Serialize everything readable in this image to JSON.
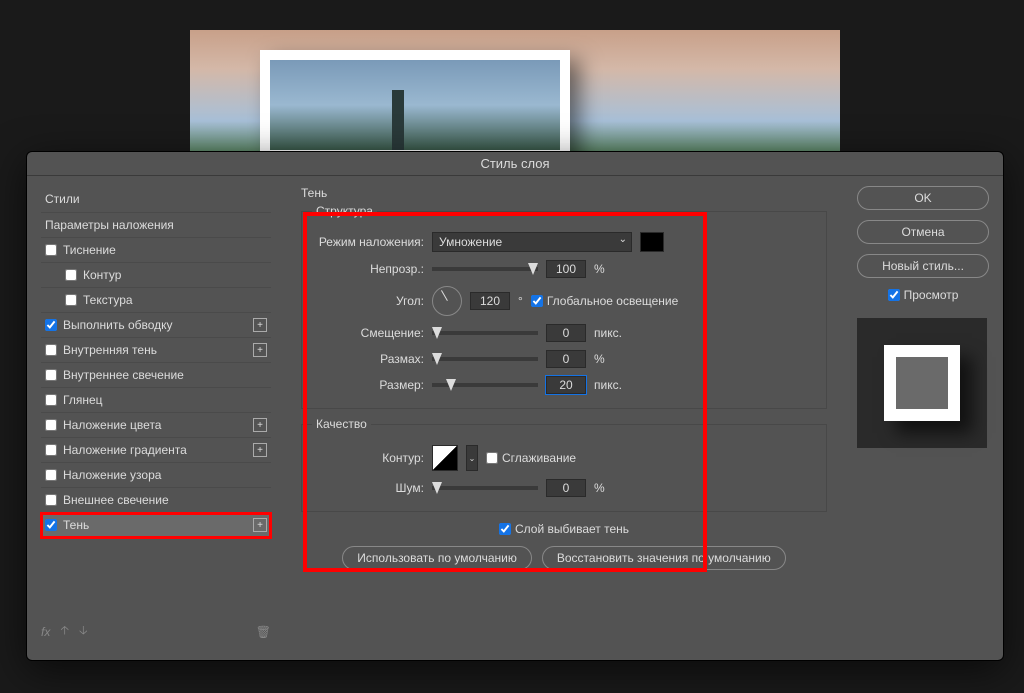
{
  "dialog": {
    "title": "Стиль слоя"
  },
  "sidebar": {
    "styles": "Стили",
    "blending": "Параметры наложения",
    "items": [
      {
        "label": "Тиснение",
        "checked": false,
        "add": false
      },
      {
        "label": "Контур",
        "checked": false,
        "add": false,
        "indent": true
      },
      {
        "label": "Текстура",
        "checked": false,
        "add": false,
        "indent": true
      },
      {
        "label": "Выполнить обводку",
        "checked": true,
        "add": true
      },
      {
        "label": "Внутренняя тень",
        "checked": false,
        "add": true
      },
      {
        "label": "Внутреннее свечение",
        "checked": false,
        "add": false
      },
      {
        "label": "Глянец",
        "checked": false,
        "add": false
      },
      {
        "label": "Наложение цвета",
        "checked": false,
        "add": true
      },
      {
        "label": "Наложение градиента",
        "checked": false,
        "add": true
      },
      {
        "label": "Наложение узора",
        "checked": false,
        "add": false
      },
      {
        "label": "Внешнее свечение",
        "checked": false,
        "add": false
      },
      {
        "label": "Тень",
        "checked": true,
        "add": true,
        "selected": true
      }
    ],
    "fx": "fx"
  },
  "main": {
    "section": "Тень",
    "structure": "Структура",
    "blend_mode_label": "Режим наложения:",
    "blend_mode_value": "Умножение",
    "opacity_label": "Непрозр.:",
    "opacity_value": "100",
    "opacity_unit": "%",
    "angle_label": "Угол:",
    "angle_value": "120",
    "angle_unit": "°",
    "global_light": "Глобальное освещение",
    "distance_label": "Смещение:",
    "distance_value": "0",
    "distance_unit": "пикс.",
    "spread_label": "Размах:",
    "spread_value": "0",
    "spread_unit": "%",
    "size_label": "Размер:",
    "size_value": "20",
    "size_unit": "пикс.",
    "quality": "Качество",
    "contour_label": "Контур:",
    "antialias": "Сглаживание",
    "noise_label": "Шум:",
    "noise_value": "0",
    "noise_unit": "%",
    "knockout": "Слой выбивает тень",
    "make_default": "Использовать по умолчанию",
    "reset_default": "Восстановить значения по умолчанию"
  },
  "right": {
    "ok": "OK",
    "cancel": "Отмена",
    "new_style": "Новый стиль...",
    "preview": "Просмотр"
  }
}
